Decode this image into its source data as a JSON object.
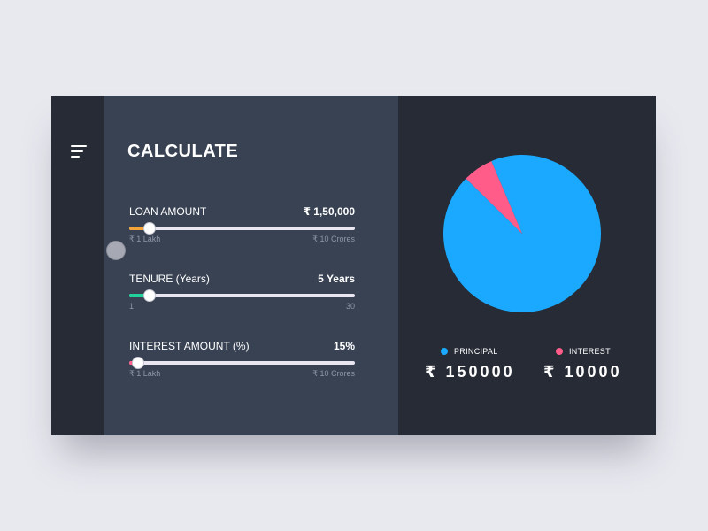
{
  "panel": {
    "title": "CALCULATE",
    "menu_icon": "hamburger-menu-icon"
  },
  "sliders": [
    {
      "label": "LOAN AMOUNT",
      "value": "₹ 1,50,000",
      "min_label": "₹ 1 Lakh",
      "max_label": "₹ 10 Crores",
      "level": 0.09,
      "color": "#f5a43a"
    },
    {
      "label": "TENURE (Years)",
      "value": "5 Years",
      "min_label": "1",
      "max_label": "30",
      "level": 0.09,
      "color": "#1fd39a"
    },
    {
      "label": "INTEREST AMOUNT (%)",
      "value": "15%",
      "min_label": "₹ 1 Lakh",
      "max_label": "₹ 10 Crores",
      "level": 0.04,
      "color": "#ff5c8a"
    }
  ],
  "legend": {
    "principal_label": "PRINCIPAL",
    "interest_label": "INTEREST",
    "principal_amount": "₹ 150000",
    "interest_amount": "₹ 10000"
  },
  "colors": {
    "principal": "#1aa9ff",
    "interest": "#ff5c8a"
  },
  "chart_data": {
    "type": "pie",
    "labels": [
      "PRINCIPAL",
      "INTEREST"
    ],
    "values": [
      150000,
      10000
    ]
  }
}
